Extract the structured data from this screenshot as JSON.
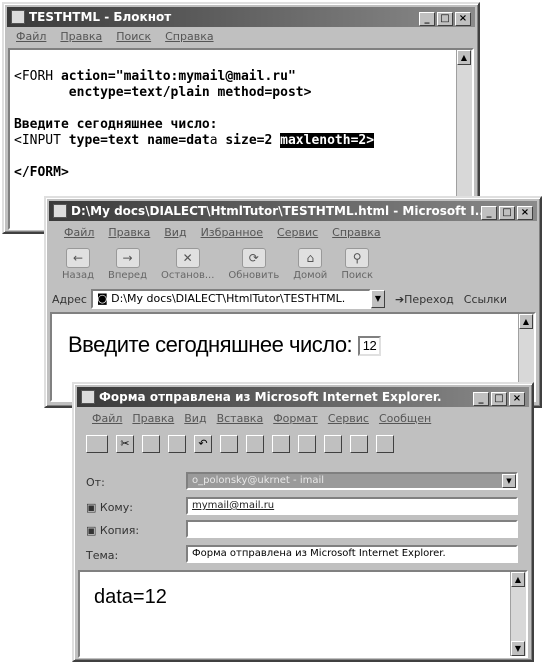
{
  "notepad": {
    "title": "TESTHTML - Блокнот",
    "menu": [
      "Файл",
      "Правка",
      "Поиск",
      "Справка"
    ],
    "lines": [
      {
        "pre": "<FORH ",
        "b": "action=\"mailto:mymail@mail.ru\"",
        "post": ""
      },
      {
        "pre": "       ",
        "b": "enctype=text/plain method=post>",
        "post": ""
      },
      {
        "pre": "",
        "b": "",
        "post": ""
      },
      {
        "pre": "",
        "b": "Введите сегодняшнее",
        "post": " число:"
      },
      {
        "pre": "<INPUT ",
        "b": "type=text name=dat",
        "post": "a "
      },
      {
        "pre": "",
        "b": "",
        "post": ""
      },
      {
        "pre": "",
        "b": "</FORM>",
        "post": ""
      }
    ],
    "line5_size": "size=2 ",
    "line5_highlight": "maxlenoth=2>"
  },
  "browser": {
    "title": "D:\\My docs\\DIALECT\\HtmlTutor\\TESTHTML.html - Microsoft I...",
    "menu": [
      "Файл",
      "Правка",
      "Вид",
      "Избранное",
      "Сервис",
      "Справка"
    ],
    "toolbar": [
      {
        "label": "Назад",
        "icon": "back-arrow-icon",
        "glyph": "←"
      },
      {
        "label": "Вперед",
        "icon": "forward-arrow-icon",
        "glyph": "→"
      },
      {
        "label": "Останов...",
        "icon": "stop-icon",
        "glyph": "✕"
      },
      {
        "label": "Обновить",
        "icon": "refresh-icon",
        "glyph": "⟳"
      },
      {
        "label": "Домой",
        "icon": "home-icon",
        "glyph": "⌂"
      },
      {
        "label": "Поиск",
        "icon": "search-icon",
        "glyph": "⚲"
      }
    ],
    "address_label": "Адрес",
    "address_value": "D:\\My docs\\DIALECT\\HtmlTutor\\TESTHTML.",
    "go_label": "Переход",
    "links_label": "Ссылки",
    "page_prompt": "Введите сегодняшнее число:",
    "input_value": "12"
  },
  "mail": {
    "title": "Форма отправлена из Microsoft Internet Explorer.",
    "menu": [
      "Файл",
      "Правка",
      "Вид",
      "Вставка",
      "Формат",
      "Сервис",
      "Сообщен"
    ],
    "from_label": "От:",
    "from_value": "o_polonsky@ukrnet - imail",
    "to_label": "Кому:",
    "to_value": "mymail@mail.ru",
    "cc_label": "Копия:",
    "cc_value": "",
    "subject_label": "Тема:",
    "subject_value": "Форма отправлена из Microsoft Internet Explorer.",
    "body": "data=12"
  }
}
